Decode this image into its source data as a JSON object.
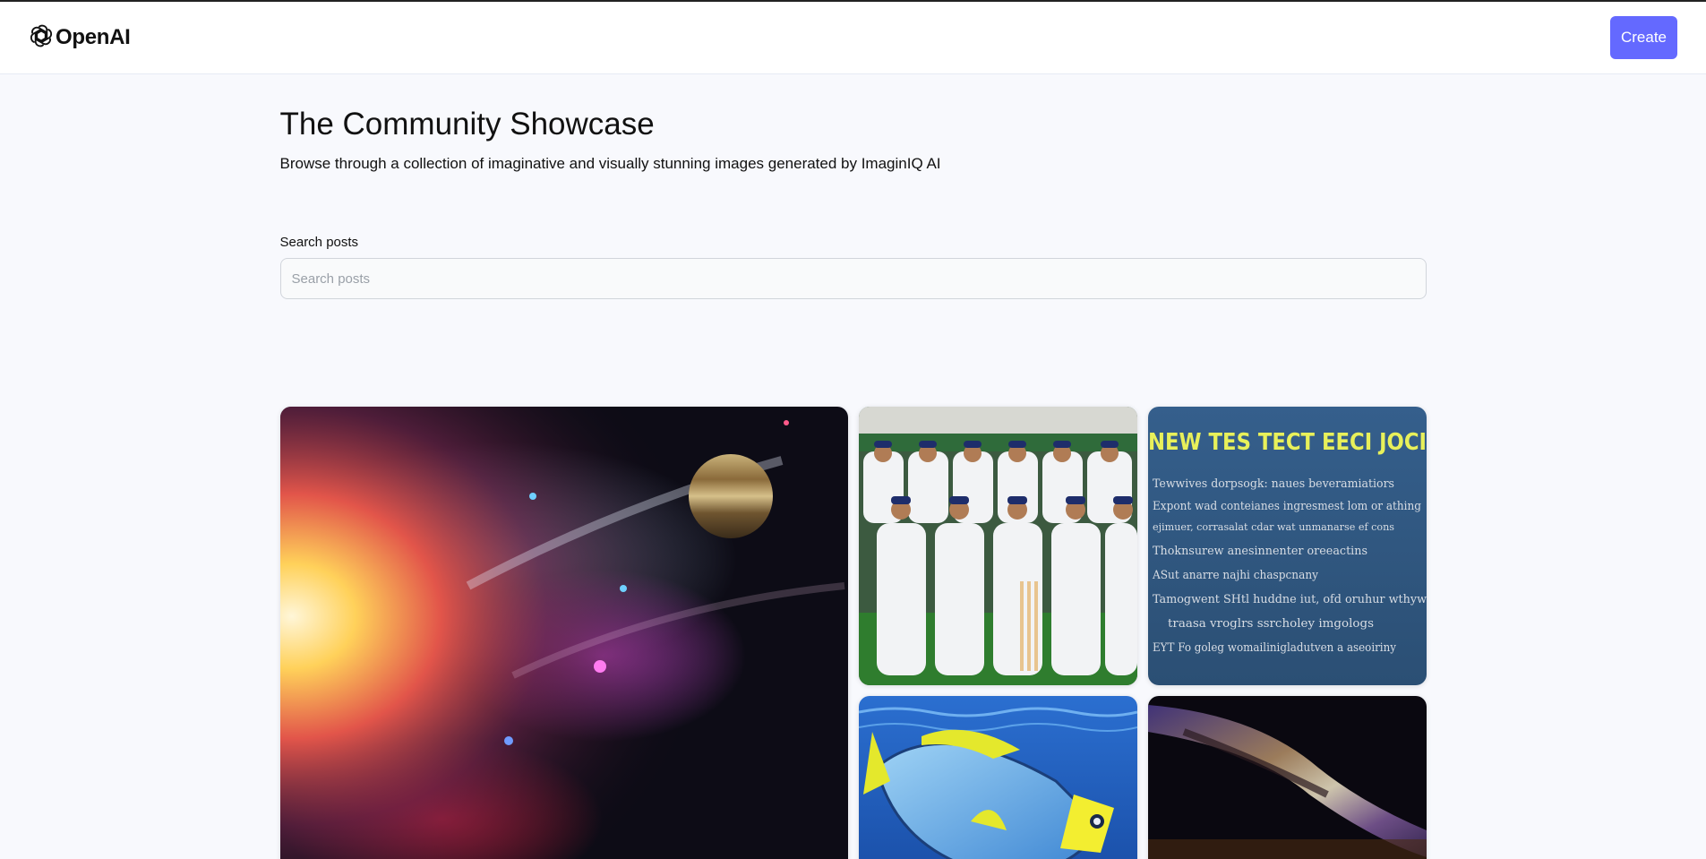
{
  "header": {
    "brand": "OpenAI",
    "create_label": "Create"
  },
  "main": {
    "title": "The Community Showcase",
    "subtitle": "Browse through a collection of imaginative and visually stunning images generated by ImaginIQ AI",
    "search_label": "Search posts",
    "search_placeholder": "Search posts"
  },
  "posts": [
    {
      "subject": "space nebula with planet"
    },
    {
      "subject": "cricket team group photo"
    },
    {
      "subject": "newspaper text image",
      "headline": "NEW TES TECT EECI JOCI",
      "lines": [
        "Tewwives dorpsogk: naues beveramiatiors",
        "Expont wad conteianes ingresmest lom or athing",
        "ejimuer, corrasalat cdar wat unmanarse ef cons",
        "Thoknsurew anesinnenter oreeactins",
        "ASut anarre najhi chaspcnany",
        "Tamogwent SHtl huddne iut, ofd oruhur wthyw",
        "traasa vroglrs ssrcholey imgologs",
        "EYT Fo goleg womailinigladutven a aseoiriny"
      ]
    },
    {
      "subject": "blue tropical fish"
    },
    {
      "subject": "milky way galaxy"
    }
  ]
}
